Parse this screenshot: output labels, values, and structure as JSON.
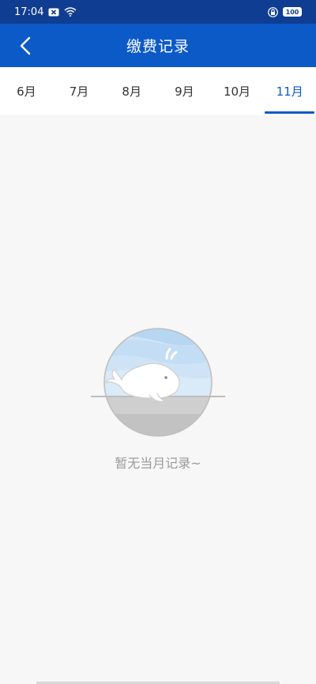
{
  "status_bar": {
    "time": "17:04",
    "battery": "100",
    "icons": [
      "notification-x-icon",
      "wifi-icon",
      "lock-icon",
      "battery-icon"
    ]
  },
  "header": {
    "title": "缴费记录",
    "back_icon": "chevron-left-icon"
  },
  "tabs": [
    {
      "label": "6月",
      "active": false
    },
    {
      "label": "7月",
      "active": false
    },
    {
      "label": "8月",
      "active": false
    },
    {
      "label": "9月",
      "active": false
    },
    {
      "label": "10月",
      "active": false
    },
    {
      "label": "11月",
      "active": true
    }
  ],
  "empty_state": {
    "illustration": "whale-illustration",
    "message": "暂无当月记录~"
  },
  "colors": {
    "status_bar_bg": "#0f3d91",
    "header_bg": "#0b5ac8",
    "accent": "#0b5ac8",
    "page_bg": "#f7f7f7",
    "empty_text": "#9a9a9a"
  }
}
